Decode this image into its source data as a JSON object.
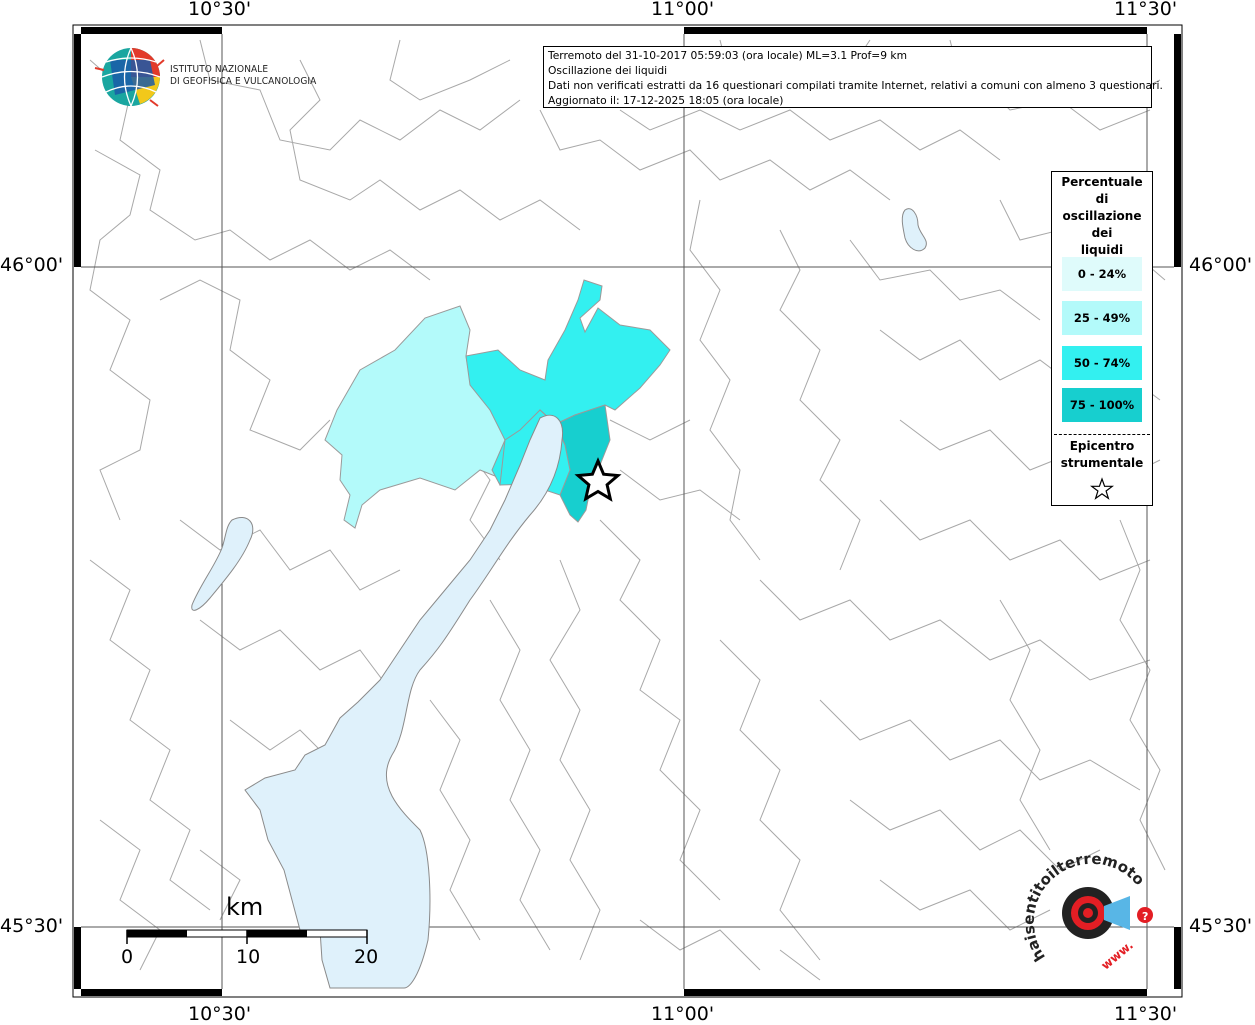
{
  "axes": {
    "lon_top": [
      "10°30'",
      "11°00'",
      "11°30'"
    ],
    "lon_bottom": [
      "10°30'",
      "11°00'",
      "11°30'"
    ],
    "lat_left": [
      "46°00'",
      "45°30'"
    ],
    "lat_right": [
      "46°00'",
      "45°30'"
    ]
  },
  "info": {
    "line1": "Terremoto del 31-10-2017 05:59:03 (ora locale) ML=3.1 Prof=9 km",
    "line2": "Oscillazione dei liquidi",
    "line3": "Dati non verificati estratti da 16 questionari compilati tramite Internet, relativi a comuni con almeno 3 questionari.",
    "line4": "Aggiornato il: 17-12-2025 18:05 (ora locale)"
  },
  "logo": {
    "line1": "ISTITUTO NAZIONALE",
    "line2": "DI GEOFISICA E VULCANOLOGIA"
  },
  "legend": {
    "title_lines": [
      "Percentuale",
      "di",
      "oscillazione",
      "dei",
      "liquidi"
    ],
    "items": [
      {
        "label": "0 - 24%",
        "color": "#dffbfb"
      },
      {
        "label": "25 - 49%",
        "color": "#b3fafa"
      },
      {
        "label": "50 - 74%",
        "color": "#33f0f0"
      },
      {
        "label": "75 - 100%",
        "color": "#17cfcf"
      }
    ],
    "epicenter_lines": [
      "Epicentro",
      "strumentale"
    ]
  },
  "scale": {
    "unit": "km",
    "labels": [
      "0",
      "10",
      "20"
    ]
  },
  "badge": {
    "text": "haisentitoilterremoto.it",
    "www": "www."
  },
  "colors": {
    "lake": "#dff1fb",
    "border": "#a8a8a8"
  }
}
